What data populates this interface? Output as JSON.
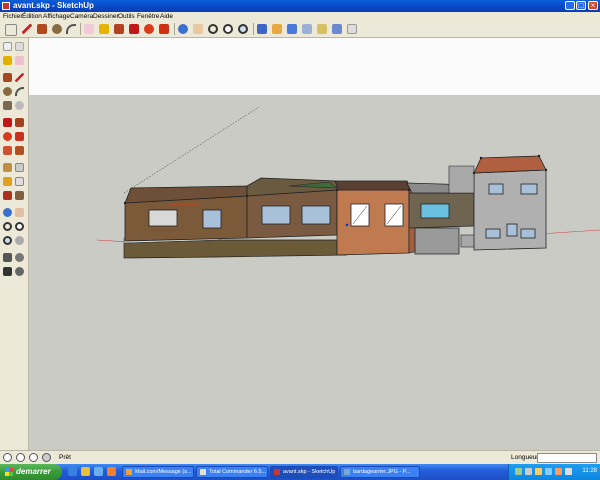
{
  "window": {
    "title": "avant.skp - SketchUp",
    "controls": {
      "minimize": "_",
      "maximize": "□",
      "close": "×"
    }
  },
  "menu": {
    "items": [
      "Fichier",
      "Édition",
      "Affichage",
      "Caméra",
      "Dessiner",
      "Outils",
      "Fenêtre",
      "Aide"
    ]
  },
  "toolbar": {
    "icons": [
      "select-icon",
      "pencil-icon",
      "rectangle-icon",
      "circle-icon",
      "arc-icon",
      "eraser-icon",
      "paint-bucket-icon",
      "push-pull-icon",
      "move-icon",
      "rotate-icon",
      "offset-icon",
      "orbit-icon",
      "pan-icon",
      "zoom-icon",
      "zoom-window-icon",
      "zoom-extents-icon",
      "iso-view-icon",
      "top-view-icon",
      "front-view-icon",
      "right-view-icon",
      "back-view-icon",
      "left-view-icon",
      "xray-icon",
      "wireframe-icon",
      "hidden-line-icon",
      "shaded-icon",
      "textured-icon"
    ]
  },
  "colors": {
    "titlebar": "#0846c4",
    "sky": "#fbfbfb",
    "ground": "#cbcbc6",
    "start_button": "#3a9a3a",
    "taskbar": "#245edb"
  },
  "status": {
    "text": "Prêt",
    "measure_label": "Longueur",
    "measure_value": ""
  },
  "taskbar": {
    "start_label": "demarrer",
    "tasks": [
      {
        "label": "Mail.com/Message (s...",
        "active": false
      },
      {
        "label": "Total Commander 6.5...",
        "active": false
      },
      {
        "label": "avant.skp - SketchUp",
        "active": true
      },
      {
        "label": "bardagearrier.JPG - P...",
        "active": false
      }
    ],
    "clock": "11:28"
  }
}
